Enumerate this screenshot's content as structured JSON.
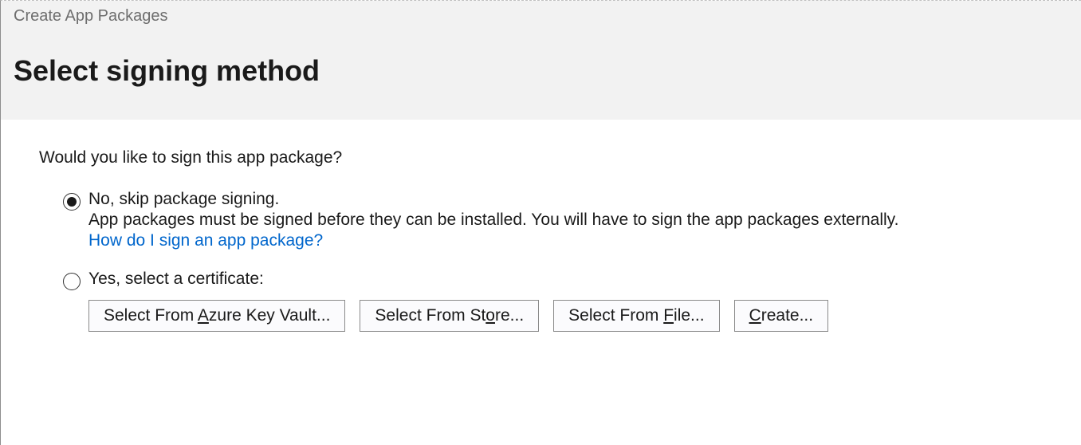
{
  "window": {
    "title": "Create App Packages"
  },
  "header": {
    "heading": "Select signing method"
  },
  "main": {
    "question": "Would you like to sign this app package?",
    "options": {
      "no": {
        "label": "No, skip package signing.",
        "description": "App packages must be signed before they can be installed. You will have to sign the app packages externally.",
        "link_text": "How do I sign an app package?",
        "selected": true
      },
      "yes": {
        "label": "Yes, select a certificate:",
        "selected": false,
        "buttons": {
          "azure_pre": "Select From ",
          "azure_mn": "A",
          "azure_post": "zure Key Vault...",
          "store_pre": "Select From St",
          "store_mn": "o",
          "store_post": "re...",
          "file_pre": "Select From ",
          "file_mn": "F",
          "file_post": "ile...",
          "create_pre": "",
          "create_mn": "C",
          "create_post": "reate..."
        }
      }
    }
  }
}
